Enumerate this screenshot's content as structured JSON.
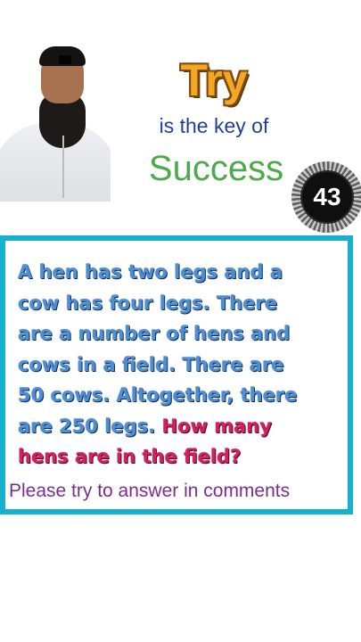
{
  "header": {
    "title": "Try",
    "tagline": "is the key of",
    "highlight_word": "Success",
    "badge_number": "43"
  },
  "question": {
    "text": "A hen has two legs and a cow has four legs. There are a number of hens and cows in a field. There are 50 cows. Altogether, there are 250  legs.",
    "prompt": "How many hens are in the field?"
  },
  "call_to_action": "Please try to answer in comments",
  "colors": {
    "title": "#f5a623",
    "tagline": "#1f3f9b",
    "success": "#4caa4a",
    "card_border": "#17b1d0",
    "question_text": "#4d8fd3",
    "question_prompt": "#d61f5f",
    "cta": "#7b2d8f"
  }
}
